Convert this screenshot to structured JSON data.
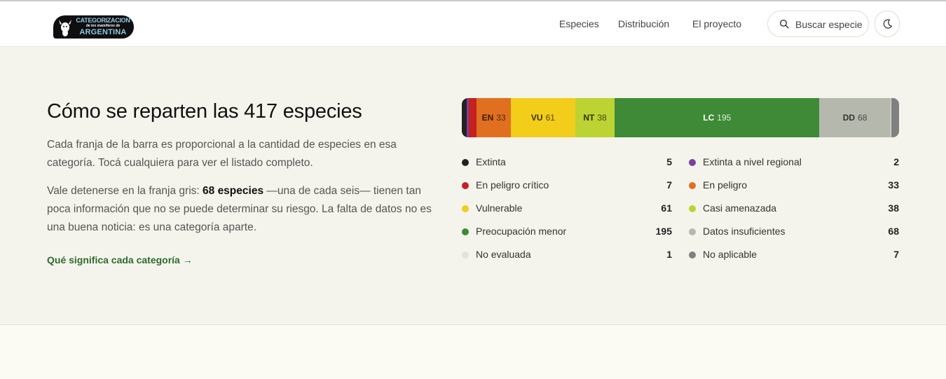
{
  "header": {
    "logo": {
      "line1": "CATEGORIZACION",
      "line2": "de los mamíferos de",
      "line3": "ARGENTINA"
    },
    "nav": [
      {
        "label": "Especies"
      },
      {
        "label": "Distribución"
      },
      {
        "label": "El proyecto"
      }
    ],
    "search_label": "Buscar especie",
    "icons": {
      "search": "search-icon",
      "theme": "moon-icon",
      "logo": "deer-icon"
    }
  },
  "summary": {
    "title": "Cómo se reparten las 417 especies",
    "paragraph1": "Cada franja de la barra es proporcional a la cantidad de especies en esa categoría. Tocá cualquiera para ver el listado completo.",
    "paragraph2_pre": "Vale detenerse en la franja gris: ",
    "paragraph2_bold": "68 especies",
    "paragraph2_post": " —una de cada seis— tienen tan poca información que no se puede determinar su riesgo. La falta de datos no es una buena noticia: es una categoría aparte.",
    "link": "Qué significa cada categoría →"
  },
  "categories": [
    {
      "code": "EX",
      "label": "Extinta",
      "count": 5,
      "color": "#222222",
      "text": "#ffffff",
      "show": false
    },
    {
      "code": "EW",
      "label": "Extinta a nivel regional",
      "count": 2,
      "color": "#7b3fa0",
      "text": "#ffffff",
      "show": false
    },
    {
      "code": "CR",
      "label": "En peligro crítico",
      "count": 7,
      "color": "#c62020",
      "text": "#ffffff",
      "show": false
    },
    {
      "code": "EN",
      "label": "En peligro",
      "count": 33,
      "color": "#e07020",
      "text": "#3a1a00",
      "show": true
    },
    {
      "code": "VU",
      "label": "Vulnerable",
      "count": 61,
      "color": "#f2cd1a",
      "text": "#3a3000",
      "show": true
    },
    {
      "code": "NT",
      "label": "Casi amenazada",
      "count": 38,
      "color": "#bcd333",
      "text": "#2a3300",
      "show": true
    },
    {
      "code": "LC",
      "label": "Preocupación menor",
      "count": 195,
      "color": "#3e8a36",
      "text": "#ffffff",
      "show": true
    },
    {
      "code": "DD",
      "label": "Datos insuficientes",
      "count": 68,
      "color": "#b5b9ad",
      "text": "#333333",
      "show": true
    },
    {
      "code": "NE",
      "label": "No evaluada",
      "count": 1,
      "color": "#e2e2dc",
      "text": "#333333",
      "show": false
    },
    {
      "code": "NA",
      "label": "No aplicable",
      "count": 7,
      "color": "#808080",
      "text": "#ffffff",
      "show": false
    }
  ],
  "legend_order": [
    "EX",
    "EW",
    "CR",
    "EN",
    "VU",
    "NT",
    "LC",
    "DD",
    "NE",
    "NA"
  ]
}
